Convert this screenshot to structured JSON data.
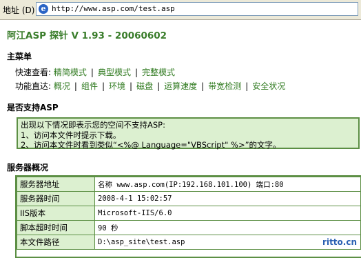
{
  "address_bar": {
    "label": "地址 (D)",
    "url": "http://www.asp.com/test.asp"
  },
  "page": {
    "title": "阿江ASP 探针  V 1.93 - 20060602",
    "main_menu_heading": "主菜单",
    "quick_view_label": "快速查看:",
    "quick_view_links": [
      "精简模式",
      "典型模式",
      "完整模式"
    ],
    "function_label": "功能直达:",
    "function_links": [
      "概况",
      "组件",
      "环境",
      "磁盘",
      "运算速度",
      "带宽检测",
      "安全状况"
    ],
    "asp_support_heading": "是否支持ASP",
    "notice_lines": [
      "出现以下情况即表示您的空间不支持ASP:",
      "1、访问本文件时提示下载。",
      "2、访问本文件时看到类似“<%@ Language=\"VBScript\" %>”的文字。"
    ],
    "server_overview_heading": "服务器概况",
    "server_table": [
      {
        "key": "服务器地址",
        "value": "名称 www.asp.com(IP:192.168.101.100) 端口:80"
      },
      {
        "key": "服务器时间",
        "value": "2008-4-1 15:02:57"
      },
      {
        "key": "IIS版本",
        "value": "Microsoft-IIS/6.0"
      },
      {
        "key": "脚本超时时间",
        "value": "90 秒"
      },
      {
        "key": "本文件路径",
        "value": "D:\\asp_site\\test.asp"
      }
    ],
    "watermark": "ritto.cn"
  },
  "colors": {
    "title_green": "#3a7d2b",
    "link_green": "#2f7a1f",
    "panel_bg": "#dcf0d0",
    "border_green": "#5c8f44"
  }
}
